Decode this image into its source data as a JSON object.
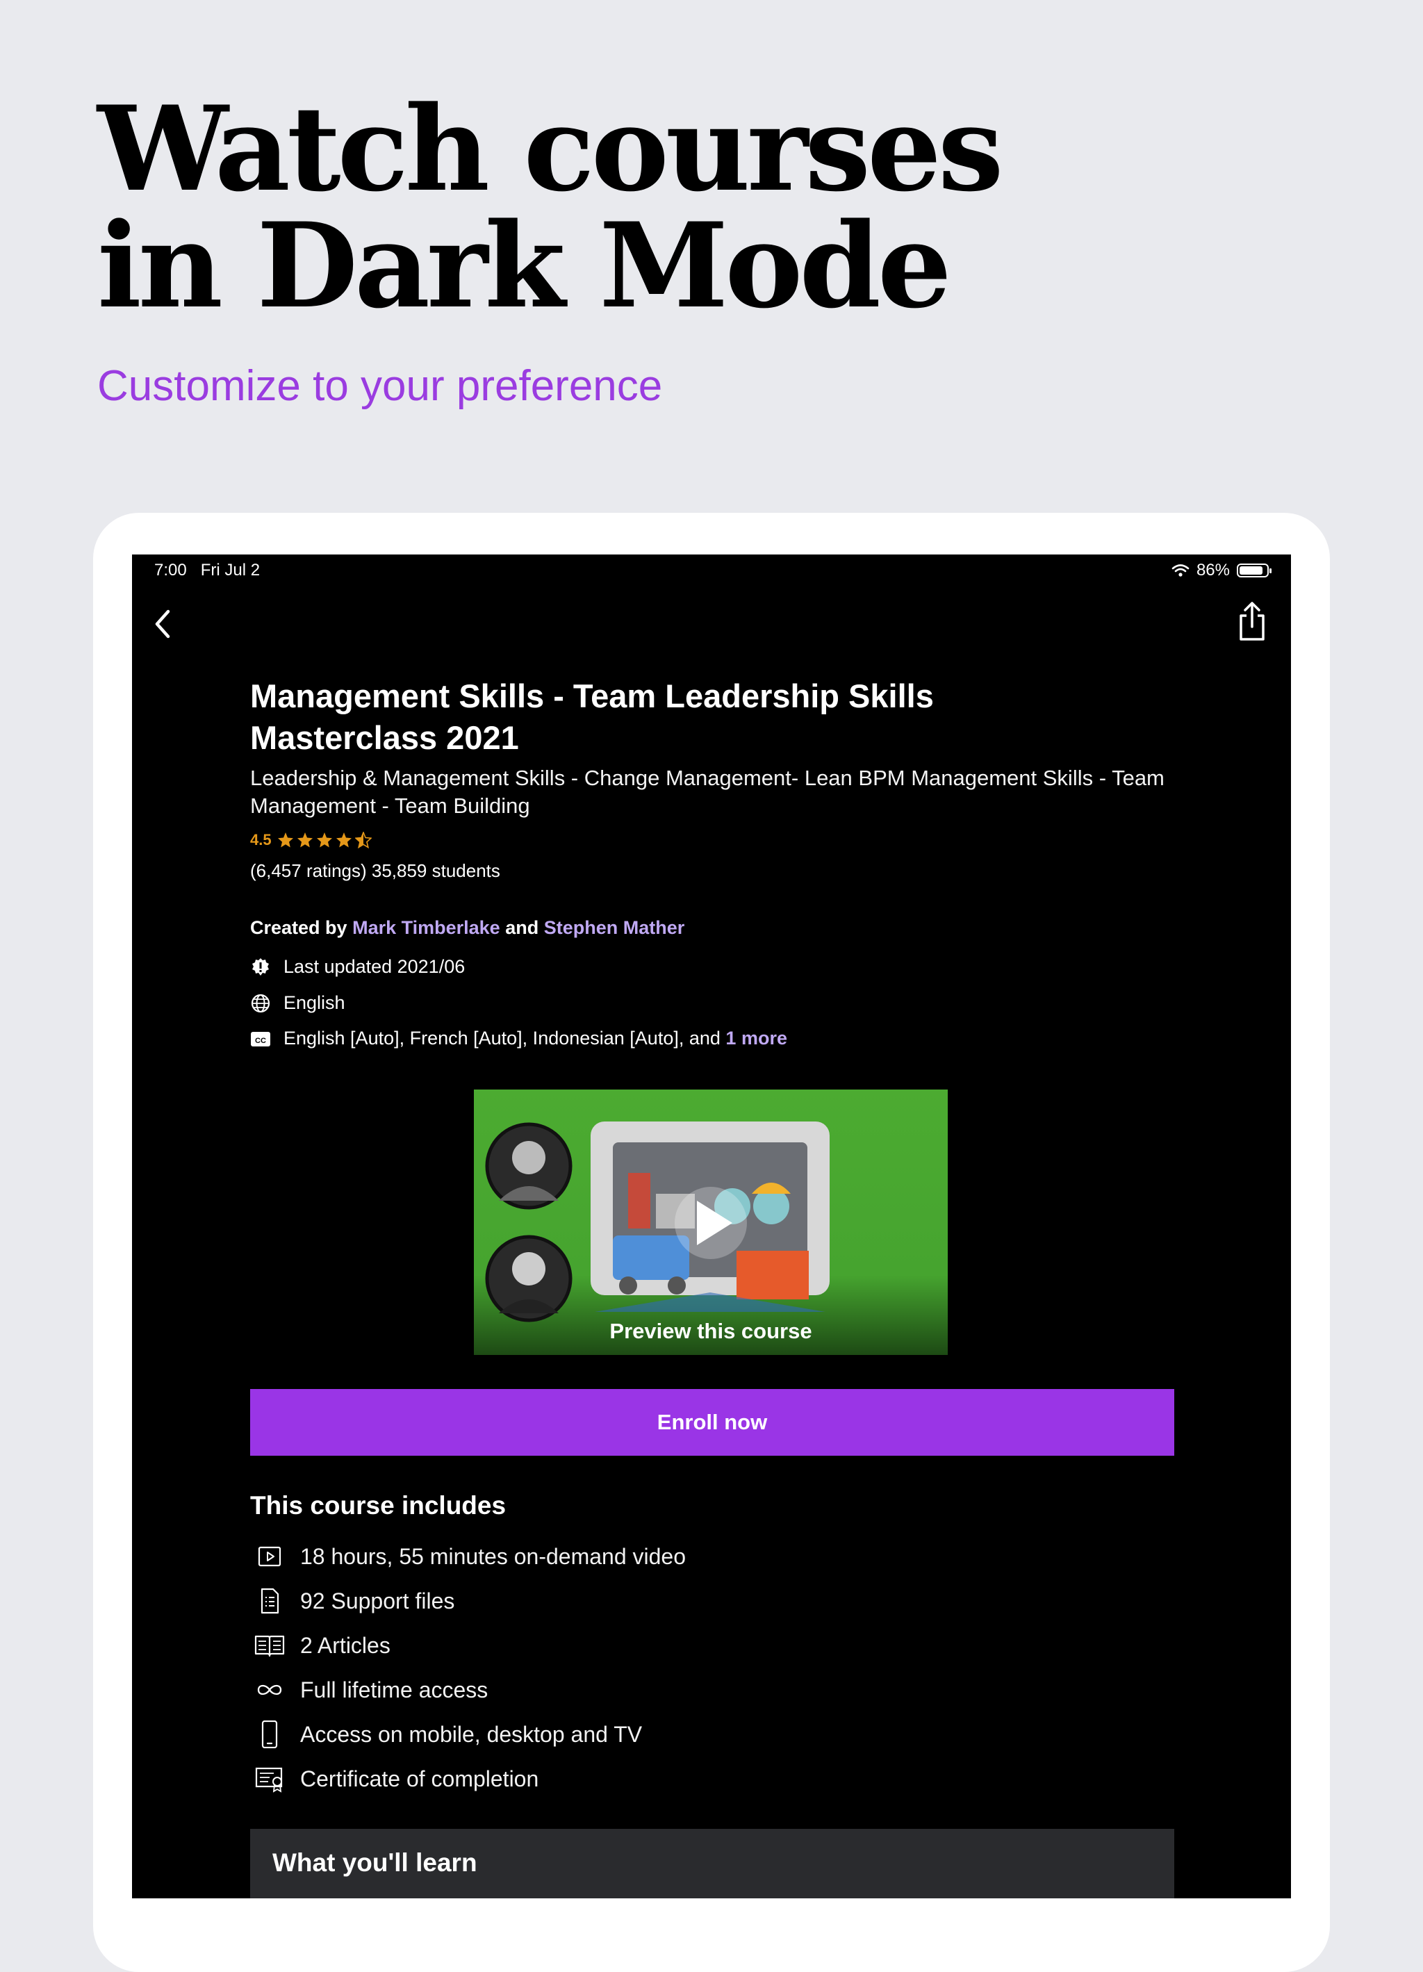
{
  "hero": {
    "title_line1": "Watch courses",
    "title_line2": "in Dark Mode",
    "subtitle": "Customize to your preference"
  },
  "status_bar": {
    "time": "7:00",
    "date": "Fri Jul 2",
    "battery": "86%",
    "battery_level": 0.86
  },
  "course": {
    "title": "Management Skills - Team Leadership Skills Masterclass 2021",
    "subtitle": "Leadership & Management Skills - Change Management- Lean BPM Management Skills - Team Management - Team Building",
    "rating": "4.5",
    "stars": 4.5,
    "ratings_text": "(6,457 ratings) 35,859 students",
    "created_by_label": "Created by",
    "author1": "Mark Timberlake",
    "and_label": "and",
    "author2": "Stephen Mather",
    "last_updated": "Last updated 2021/06",
    "language": "English",
    "captions": "English [Auto], French [Auto], Indonesian [Auto], and",
    "captions_more": "1 more",
    "preview_label": "Preview this course",
    "enroll_label": "Enroll now"
  },
  "includes": {
    "title": "This course includes",
    "items": [
      {
        "icon": "video-icon",
        "label": "18 hours, 55 minutes on-demand video"
      },
      {
        "icon": "file-list-icon",
        "label": "92 Support files"
      },
      {
        "icon": "article-icon",
        "label": "2 Articles"
      },
      {
        "icon": "infinity-icon",
        "label": "Full lifetime access"
      },
      {
        "icon": "mobile-icon",
        "label": "Access on mobile, desktop and TV"
      },
      {
        "icon": "certificate-icon",
        "label": "Certificate of completion"
      }
    ]
  },
  "learn": {
    "title": "What you'll learn"
  },
  "colors": {
    "accent": "#9a35e6",
    "link": "#c0a9f3",
    "star": "#e59819",
    "hero_subtitle": "#9a3ce0"
  }
}
